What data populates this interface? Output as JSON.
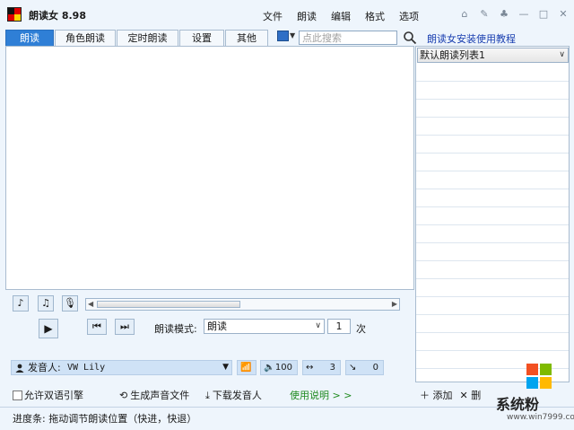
{
  "window": {
    "title": "朗读女 8.98"
  },
  "menu": [
    "文件",
    "朗读",
    "编辑",
    "格式",
    "选项"
  ],
  "window_controls": [
    "home-icon",
    "pin-icon",
    "shirt-icon",
    "minimize-icon",
    "maximize-icon",
    "close-icon"
  ],
  "tabs": [
    {
      "label": "朗读",
      "active": true
    },
    {
      "label": "角色朗读",
      "active": false
    },
    {
      "label": "定时朗读",
      "active": false
    },
    {
      "label": "设置",
      "active": false
    },
    {
      "label": "其他",
      "active": false
    }
  ],
  "search": {
    "placeholder": "点此搜索",
    "value": ""
  },
  "help_link": "朗读女安装使用教程",
  "list": {
    "selected": "默认朗读列表1",
    "add_label": "添加",
    "remove_label": "删"
  },
  "playback": {
    "mode_label": "朗读模式:",
    "mode_value": "朗读",
    "times_value": "1",
    "times_unit": "次"
  },
  "speaker": {
    "label": "发音人:",
    "value": "VW Lily"
  },
  "params": {
    "volume": "100",
    "speed": "3",
    "pitch": "0"
  },
  "options": {
    "allow_dual_engine": "允许双语引擎",
    "generate_audio": "生成声音文件",
    "download_speaker": "下载发音人",
    "usage_help": "使用说明 > >"
  },
  "status": {
    "text": "进度条: 拖动调节朗读位置（快进，快退）"
  },
  "watermark": {
    "text": "系统粉",
    "url": "www.win7999.com"
  },
  "colors": {
    "accent": "#2f7fd6",
    "link": "#1a3fb0",
    "green_link": "#1f8a1f",
    "panel": "#cfe2f6"
  }
}
